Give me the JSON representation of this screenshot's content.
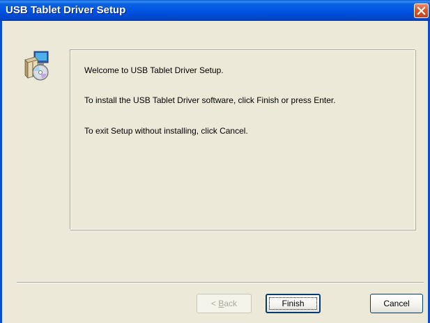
{
  "window": {
    "title": "USB Tablet Driver Setup"
  },
  "icons": {
    "titlebar_close": "close-icon",
    "setup": "setup-installer-icon"
  },
  "message": {
    "welcome": "Welcome to USB Tablet Driver Setup.",
    "install": "To install the USB Tablet Driver software, click Finish or press Enter.",
    "exit": "To exit Setup without installing, click Cancel."
  },
  "buttons": {
    "back_prefix": "< ",
    "back_mnemonic": "B",
    "back_rest": "ack",
    "finish": "Finish",
    "cancel": "Cancel"
  },
  "colors": {
    "titlebar": "#0054e3",
    "close_button": "#d9572f",
    "dialog_background": "#ece9d8"
  }
}
